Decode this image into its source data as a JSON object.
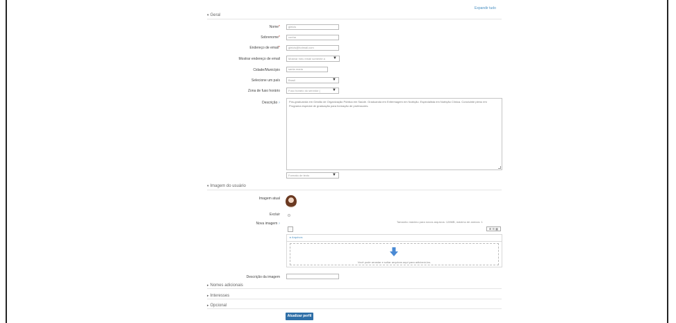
{
  "header": {
    "expand_all": "Expandir tudo"
  },
  "sections": {
    "geral": "Geral",
    "imagem": "Imagem do usuário",
    "nomes": "Nomes adicionais",
    "interesses": "Interesses",
    "opcional": "Opcional"
  },
  "fields": {
    "nome": {
      "label": "Nome",
      "value": "gleicis"
    },
    "sobrenome": {
      "label": "Sobrenome",
      "value": "cunha"
    },
    "email": {
      "label": "Endereço de email",
      "value": "gleicis@hotmail.com"
    },
    "mostrar_email": {
      "label": "Mostrar endereço de email",
      "value": "Mostrar meu email somente a"
    },
    "cidade": {
      "label": "Cidade/Município",
      "value": "santa maria"
    },
    "pais": {
      "label": "Selecione um país",
      "value": "Brasil"
    },
    "fuso": {
      "label": "Zona de fuso horário",
      "value": "Fuso horário do servidor ("
    },
    "descricao": {
      "label": "Descrição",
      "value": "Pós-graduanda em Gestão de Organização Pública em Saúde. Graduanda em Enfermagem em Nutrição. Especialista em Nutrição Clínica. Concluinte pleno em Programa especial de graduação para formação de professores.",
      "format": "Formato de texto"
    }
  },
  "imagem": {
    "atual_label": "Imagem atual",
    "excluir_label": "Excluir",
    "nova_label": "Nova imagem",
    "max_size": "Tamanho máximo para novos arquivos: 128MB, máximo de anexos: 1",
    "path_label": "Arquivos",
    "drop_text": "Você pode arrastar e soltar arquivos aqui para adicioná-los.",
    "views": "⊞ ☰ ▦",
    "descricao_label": "Descrição da imagem",
    "descricao_value": ""
  },
  "actions": {
    "submit": "Atualizar perfil"
  },
  "icons": {
    "help": "question-circle-icon",
    "dropdown": "triangle-down-icon",
    "upload": "arrow-down-icon",
    "folder": "folder-icon"
  },
  "colors": {
    "accent": "#2f6fa7",
    "link": "#4a90c2",
    "required": "#c0392b"
  }
}
